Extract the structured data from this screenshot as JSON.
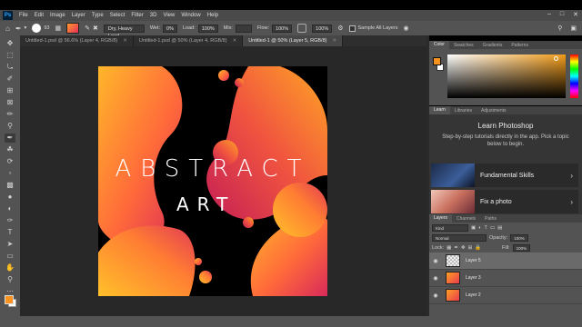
{
  "menubar": {
    "logo": "Ps",
    "items": [
      "File",
      "Edit",
      "Image",
      "Layer",
      "Type",
      "Select",
      "Filter",
      "3D",
      "View",
      "Window",
      "Help"
    ]
  },
  "options": {
    "brush_size": "93",
    "preset": "Dry, Heavy Load",
    "wet_label": "Wet:",
    "wet_value": "0%",
    "load_label": "Load:",
    "load_value": "100%",
    "mix_label": "Mix:",
    "flow_label": "Flow:",
    "flow_value": "100%",
    "zoom_value": "100%",
    "sample_label": "Sample All Layers"
  },
  "tabs": [
    {
      "label": "Untitled-1.psd @ 56.6% (Layer 4, RGB/8)"
    },
    {
      "label": "Untitled-1.psd @ 50% (Layer 4, RGB/8)"
    },
    {
      "label": "Untitled-1 @ 50% (Layer 5, RGB/8)"
    }
  ],
  "canvas": {
    "title": "ABSTRACT",
    "subtitle": "ART"
  },
  "color_panel": {
    "tabs": [
      "Color",
      "Swatches",
      "Gradients",
      "Patterns"
    ],
    "foreground": "#f7931e",
    "background": "#ffffff"
  },
  "learn_panel": {
    "tabs": [
      "Learn",
      "Libraries",
      "Adjustments"
    ],
    "title": "Learn Photoshop",
    "description": "Step-by-step tutorials directly in the app. Pick a topic below to begin.",
    "cards": [
      {
        "label": "Fundamental Skills"
      },
      {
        "label": "Fix a photo"
      }
    ]
  },
  "layers_panel": {
    "tabs": [
      "Layers",
      "Channels",
      "Paths"
    ],
    "filter": "Kind",
    "blend_mode": "Normal",
    "opacity_label": "Opacity:",
    "opacity_value": "100%",
    "lock_label": "Lock:",
    "fill_label": "Fill:",
    "fill_value": "100%",
    "layers": [
      {
        "name": "Layer 5"
      },
      {
        "name": "Layer 3"
      },
      {
        "name": "Layer 2"
      }
    ]
  }
}
